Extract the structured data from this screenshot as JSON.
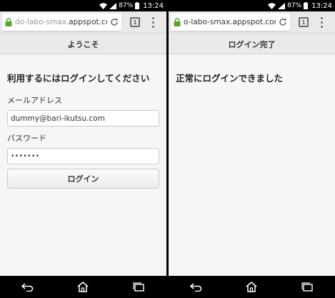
{
  "status_bar": {
    "battery": "87%",
    "time": "13:24"
  },
  "left": {
    "url_domain": "do-labo-smax.",
    "url_host": "appspot.com",
    "tab_count": "1",
    "page_title": "ようこそ",
    "heading": "利用するにはログインしてください",
    "email_label": "メールアドレス",
    "email_value": "dummy@bari-ikutsu.com",
    "password_label": "パスワード",
    "password_value": "dummyPW",
    "login_button": "ログイン"
  },
  "right": {
    "url_text": "o-labo-smax.appspot.com/v",
    "tab_count": "1",
    "page_title": "ログイン完了",
    "message": "正常にログインできました"
  },
  "colors": {
    "lock": "#5aa532",
    "toolbar": "#e9e9e9",
    "page_bg": "#f6f6f6"
  }
}
